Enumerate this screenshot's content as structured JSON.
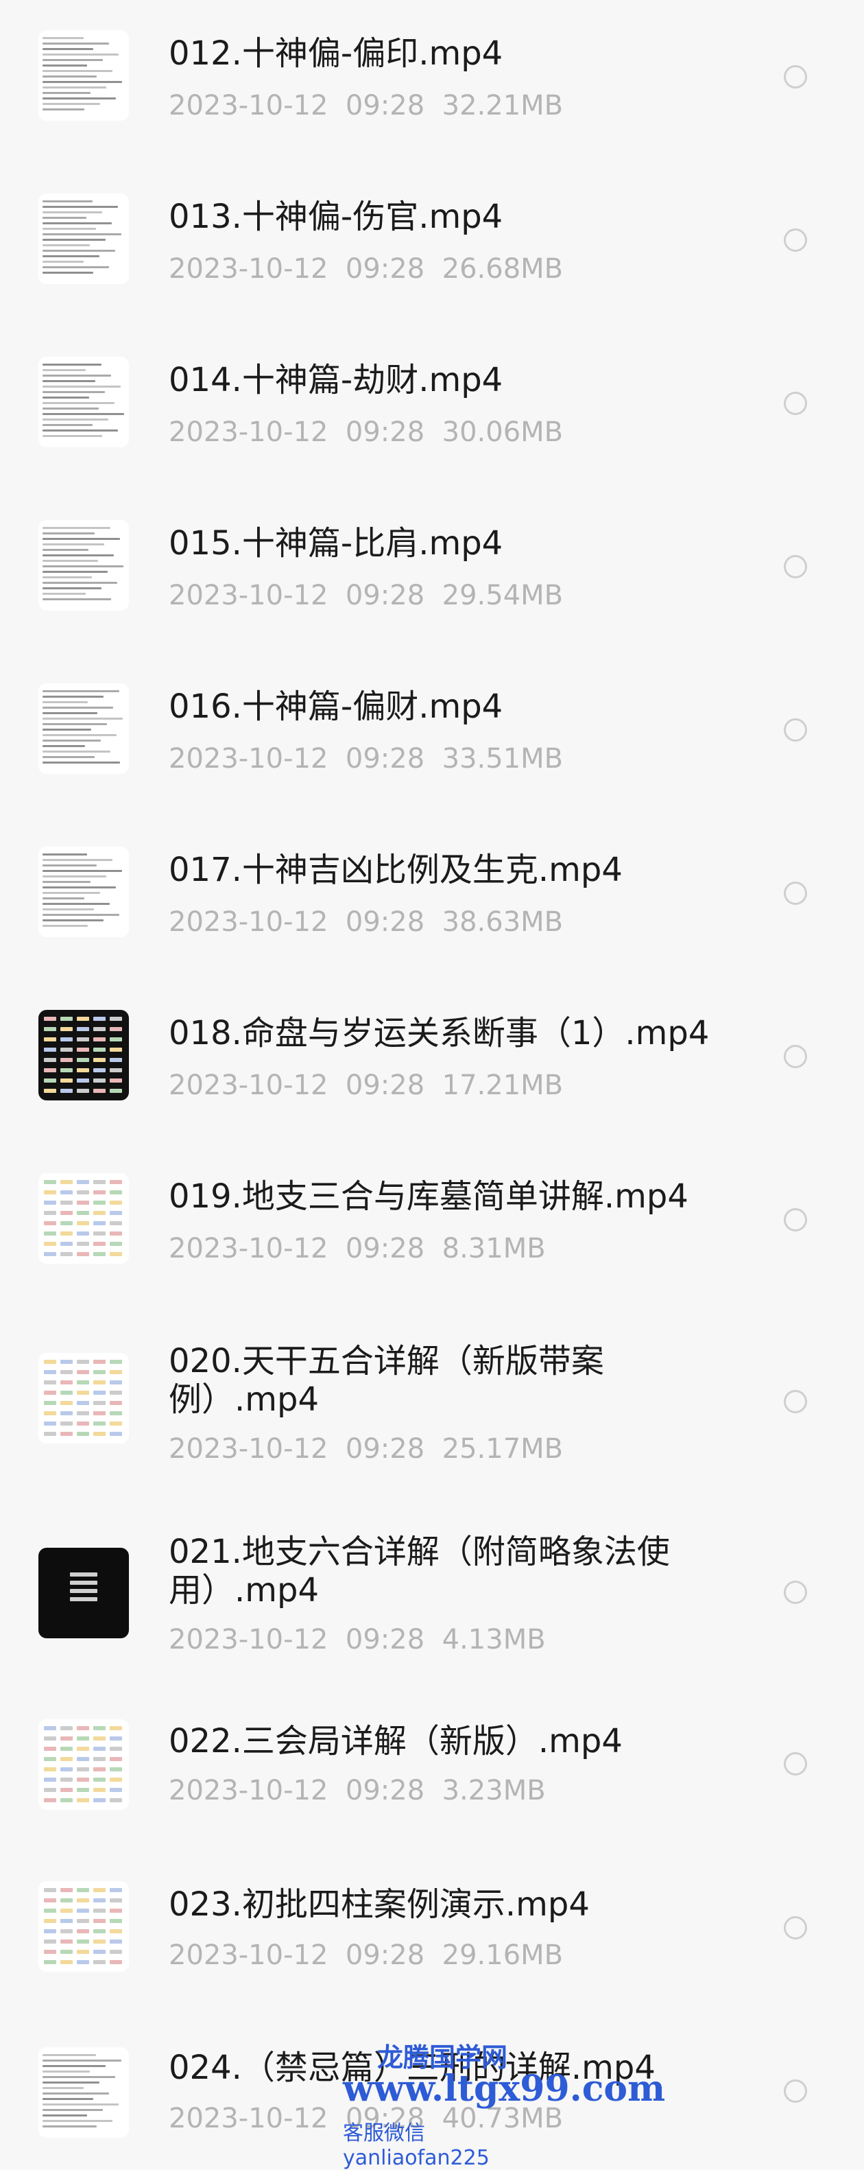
{
  "files": [
    {
      "name": "012.十神偏-偏印.mp4",
      "date": "2023-10-12",
      "time": "09:28",
      "size": "32.21MB",
      "thumb": "doc"
    },
    {
      "name": "013.十神偏-伤官.mp4",
      "date": "2023-10-12",
      "time": "09:28",
      "size": "26.68MB",
      "thumb": "doc"
    },
    {
      "name": "014.十神篇-劫财.mp4",
      "date": "2023-10-12",
      "time": "09:28",
      "size": "30.06MB",
      "thumb": "doc"
    },
    {
      "name": "015.十神篇-比肩.mp4",
      "date": "2023-10-12",
      "time": "09:28",
      "size": "29.54MB",
      "thumb": "doc"
    },
    {
      "name": "016.十神篇-偏财.mp4",
      "date": "2023-10-12",
      "time": "09:28",
      "size": "33.51MB",
      "thumb": "doc"
    },
    {
      "name": "017.十神吉凶比例及生克.mp4",
      "date": "2023-10-12",
      "time": "09:28",
      "size": "38.63MB",
      "thumb": "doc"
    },
    {
      "name": "018.命盘与岁运关系断事（1）.mp4",
      "date": "2023-10-12",
      "time": "09:28",
      "size": "17.21MB",
      "thumb": "table"
    },
    {
      "name": "019.地支三合与库墓简单讲解.mp4",
      "date": "2023-10-12",
      "time": "09:28",
      "size": "8.31MB",
      "thumb": "table"
    },
    {
      "name": "020.天干五合详解（新版带案例）.mp4",
      "date": "2023-10-12",
      "time": "09:28",
      "size": "25.17MB",
      "thumb": "table"
    },
    {
      "name": "021.地支六合详解（附简略象法使用）.mp4",
      "date": "2023-10-12",
      "time": "09:28",
      "size": "4.13MB",
      "thumb": "dark"
    },
    {
      "name": "022.三会局详解（新版）.mp4",
      "date": "2023-10-12",
      "time": "09:28",
      "size": "3.23MB",
      "thumb": "table"
    },
    {
      "name": "023.初批四柱案例演示.mp4",
      "date": "2023-10-12",
      "time": "09:28",
      "size": "29.16MB",
      "thumb": "table"
    },
    {
      "name": "024.（禁忌篇）三刑的详解.mp4",
      "date": "2023-10-12",
      "time": "09:28",
      "size": "40.73MB",
      "thumb": "doc"
    }
  ],
  "watermark": {
    "line1": "龙腾国学网",
    "line2": "www.ltgx99.com",
    "line3": "客服微信 yanliaofan225"
  },
  "colors": {
    "background": "#f7f7f7",
    "name": "#1b1b1b",
    "meta": "#b4b4b4",
    "radio": "#cfcfcf",
    "watermark": "#2e5bd6"
  }
}
